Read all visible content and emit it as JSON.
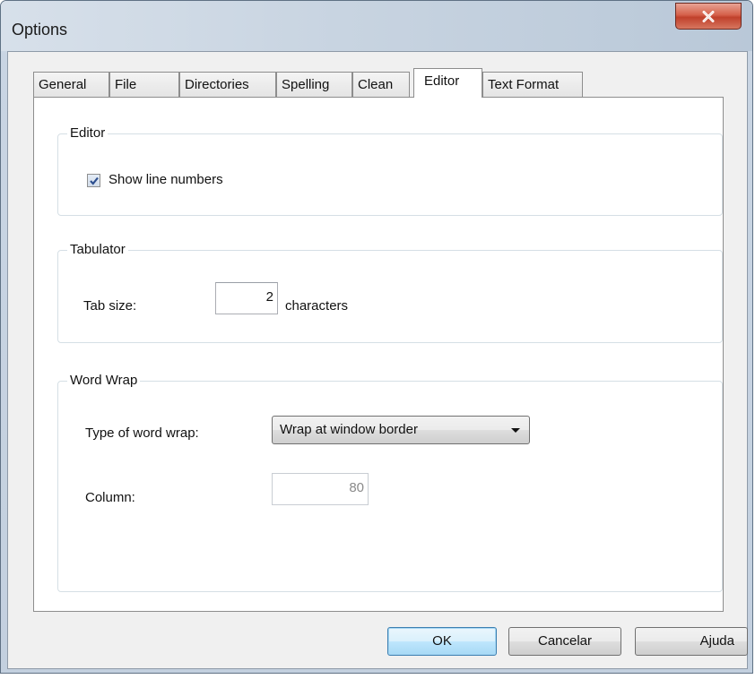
{
  "window": {
    "title": "Options"
  },
  "tabs": [
    {
      "label": "General",
      "active": false
    },
    {
      "label": "File",
      "active": false
    },
    {
      "label": "Directories",
      "active": false
    },
    {
      "label": "Spelling",
      "active": false
    },
    {
      "label": "Clean",
      "active": false
    },
    {
      "label": "Editor",
      "active": true
    },
    {
      "label": "Text Format",
      "active": false
    }
  ],
  "editor_group": {
    "label": "Editor",
    "show_line_numbers": {
      "label": "Show line numbers",
      "checked": true
    }
  },
  "tabulator_group": {
    "label": "Tabulator",
    "tab_size_label": "Tab size:",
    "tab_size_value": "2",
    "unit_label": "characters"
  },
  "word_wrap_group": {
    "label": "Word Wrap",
    "type_label": "Type of word wrap:",
    "type_value": "Wrap at window border",
    "column_label": "Column:",
    "column_value": "80",
    "column_enabled": false
  },
  "footer": {
    "ok_label": "OK",
    "cancel_label": "Cancelar",
    "help_label": "Ajuda"
  },
  "colors": {
    "close_button": "#c7432d",
    "default_button_border": "#3c7fb1",
    "checkbox_check": "#2d4f8f"
  },
  "icons": {
    "close": "close-icon",
    "checkmark": "checkmark-icon",
    "dropdown": "chevron-down-icon"
  }
}
